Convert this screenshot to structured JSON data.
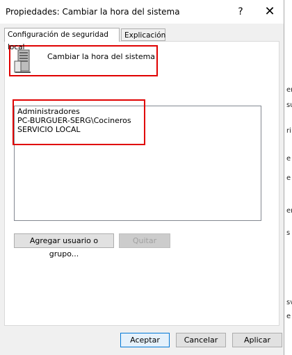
{
  "window": {
    "title": "Propiedades: Cambiar la hora del sistema",
    "help_glyph": "?",
    "close_glyph": "✕"
  },
  "tabs": [
    {
      "label": "Configuración de seguridad local",
      "active": true
    },
    {
      "label": "Explicación",
      "active": false
    }
  ],
  "policy": {
    "name": "Cambiar la hora del sistema",
    "icon": "server-icon"
  },
  "accounts": [
    "Administradores",
    "PC-BURGUER-SERG\\Cocineros",
    "SERVICIO LOCAL"
  ],
  "buttons": {
    "add": "Agregar usuario o grupo...",
    "remove": "Quitar",
    "ok": "Aceptar",
    "cancel": "Cancelar",
    "apply": "Aplicar"
  },
  "highlight_color": "#e00000",
  "background_strip": [
    "er",
    "su",
    "ri",
    "e",
    "e",
    "er",
    "s",
    "sv",
    "e"
  ]
}
